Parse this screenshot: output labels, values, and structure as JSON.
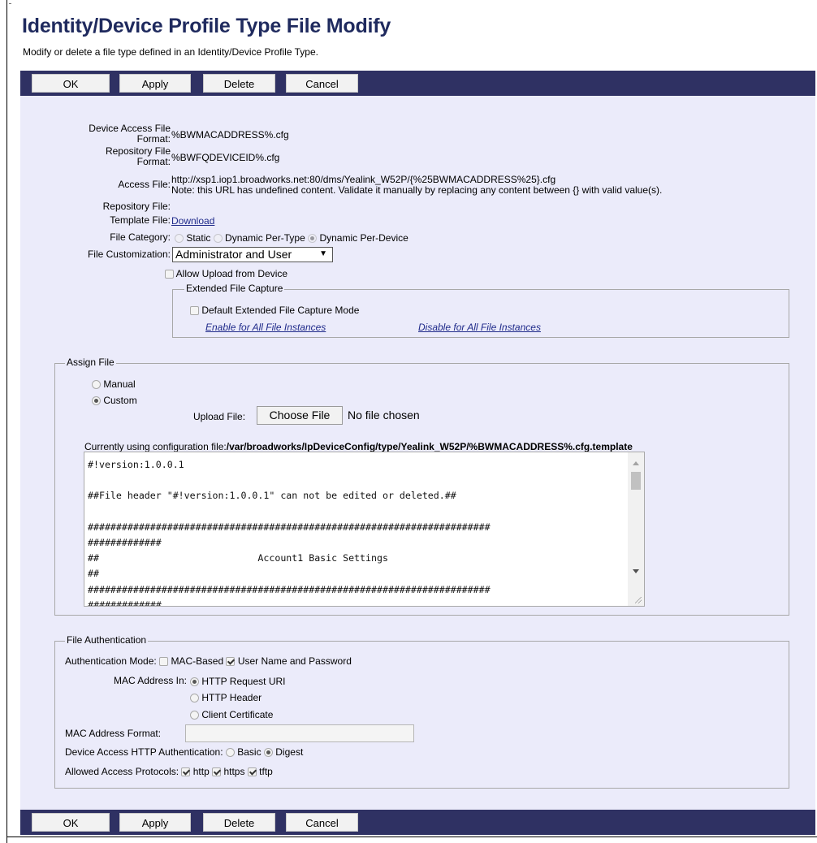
{
  "header": {
    "title": "Identity/Device Profile Type File Modify",
    "subtitle": "Modify or delete a file type defined in an Identity/Device Profile Type."
  },
  "toolbar": {
    "ok": "OK",
    "apply": "Apply",
    "delete": "Delete",
    "cancel": "Cancel"
  },
  "form": {
    "device_access_file_format_label_1": "Device Access File",
    "device_access_file_format_label_2": "Format:",
    "device_access_file_format_value": "%BWMACADDRESS%.cfg",
    "repository_file_format_label_1": "Repository File",
    "repository_file_format_label_2": "Format:",
    "repository_file_format_value": "%BWFQDEVICEID%.cfg",
    "access_file_label": "Access File:",
    "access_file_url": "http://xsp1.iop1.broadworks.net:80/dms/Yealink_W52P/{%25BWMACADDRESS%25}.cfg",
    "access_file_note": "Note: this URL has undefined content. Validate it manually by replacing any content between {} with valid value(s).",
    "repository_file_label": "Repository File:",
    "template_file_label": "Template File:",
    "template_file_link": "Download",
    "file_category_label": "File Category:",
    "file_category_options": [
      "Static",
      "Dynamic Per-Type",
      "Dynamic Per-Device"
    ],
    "file_customization_label": "File Customization:",
    "file_customization_value": "Administrator and User",
    "allow_upload_label": "Allow Upload from Device"
  },
  "extended_capture": {
    "legend": "Extended File Capture",
    "default_mode_label": "Default Extended File Capture Mode",
    "enable_all_link": "Enable for All File Instances",
    "disable_all_link": "Disable for All File Instances"
  },
  "assign_file": {
    "legend": "Assign File",
    "manual_label": "Manual",
    "custom_label": "Custom",
    "upload_file_label": "Upload File:",
    "choose_file_button": "Choose File",
    "no_file_chosen": "No file chosen",
    "currently_using_label": "Currently using configuration file:",
    "currently_using_path": "/var/broadworks/IpDeviceConfig/type/Yealink_W52P/%BWMACADDRESS%.cfg.template",
    "file_content": "#!version:1.0.0.1\n\n##File header \"#!version:1.0.0.1\" can not be edited or deleted.##\n\n#######################################################################\n#############\n##                            Account1 Basic Settings\n##\n#######################################################################\n#############"
  },
  "authentication": {
    "legend": "File Authentication",
    "mode_label": "Authentication Mode:",
    "mac_based_label": "MAC-Based",
    "user_pass_label": "User Name and Password",
    "mac_in_label": "MAC Address In:",
    "http_request_uri": "HTTP Request URI",
    "http_header": "HTTP Header",
    "client_certificate": "Client Certificate",
    "mac_format_label": "MAC Address Format:",
    "mac_format_value": "",
    "http_auth_label": "Device Access HTTP Authentication:",
    "basic_label": "Basic",
    "digest_label": "Digest",
    "protocols_label": "Allowed Access Protocols:",
    "http_label": "http",
    "https_label": "https",
    "tftp_label": "tftp"
  }
}
